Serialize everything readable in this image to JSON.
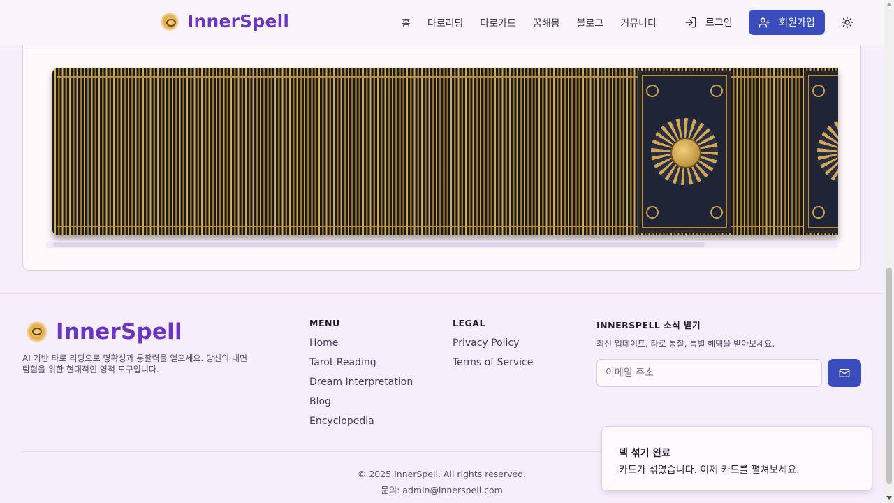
{
  "header": {
    "brand": "InnerSpell",
    "nav": [
      "홈",
      "타로리딩",
      "타로카드",
      "꿈해몽",
      "블로그",
      "커뮤니티"
    ],
    "login_label": "로그인",
    "signup_label": "회원가입"
  },
  "footer": {
    "brand": "InnerSpell",
    "description": "AI 기반 타로 리딩으로 명확성과 통찰력을 얻으세요. 당신의 내면 탐험을 위한 현대적인 영적 도구입니다.",
    "menu_heading": "MENU",
    "menu_links": [
      "Home",
      "Tarot Reading",
      "Dream Interpretation",
      "Blog",
      "Encyclopedia"
    ],
    "legal_heading": "LEGAL",
    "legal_links": [
      "Privacy Policy",
      "Terms of Service"
    ],
    "newsletter_heading": "INNERSPELL 소식 받기",
    "newsletter_sub": "최신 업데이트, 타로 통찰, 특별 혜택을 받아보세요.",
    "email_placeholder": "이메일 주소",
    "copyright": "© 2025 InnerSpell. All rights reserved.",
    "contact": "문의: admin@innerspell.com"
  },
  "toast": {
    "title": "덱 섞기 완료",
    "body": "카드가 섞였습니다. 이제 카드를 펼쳐보세요."
  },
  "colors": {
    "brand_purple": "#6a35c0",
    "primary_blue": "#3b4dbd",
    "card_gold": "#c9a24a",
    "card_navy": "#1f2437"
  }
}
